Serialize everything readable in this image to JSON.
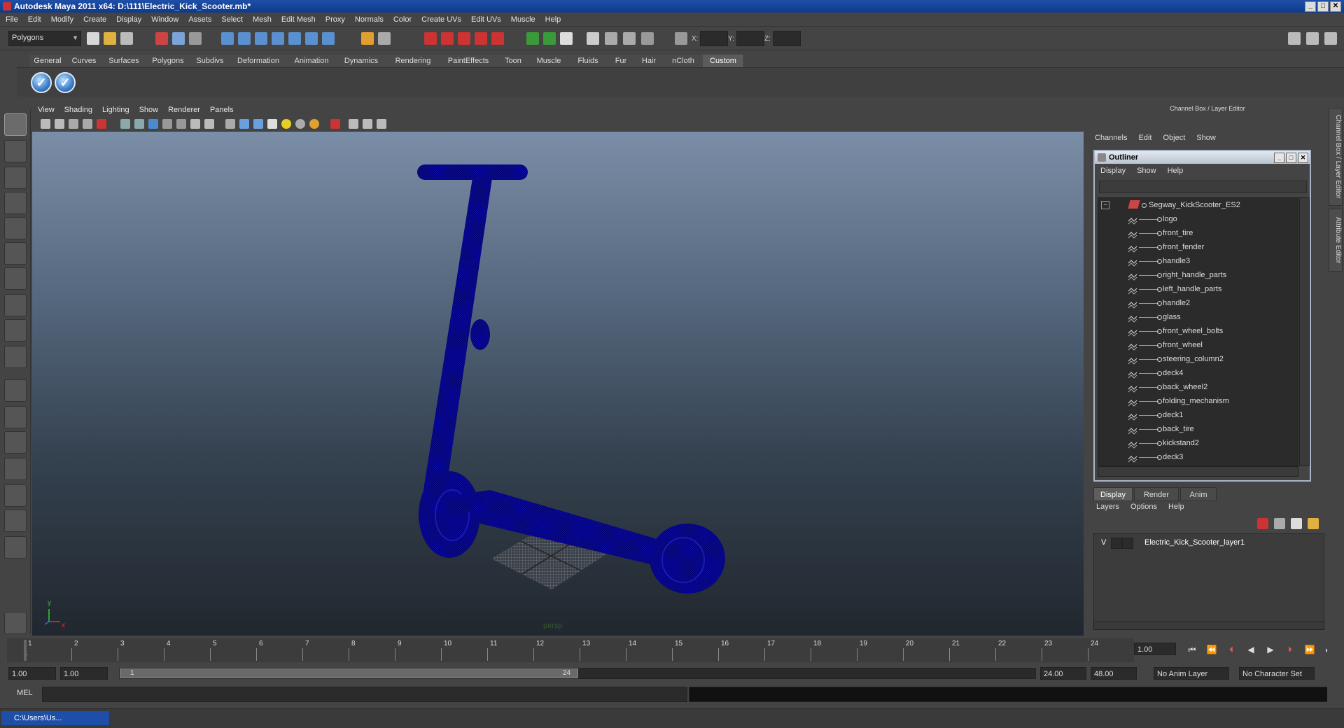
{
  "window": {
    "title": "Autodesk Maya 2011 x64: D:\\111\\Electric_Kick_Scooter.mb*"
  },
  "menubar": [
    "File",
    "Edit",
    "Modify",
    "Create",
    "Display",
    "Window",
    "Assets",
    "Select",
    "Mesh",
    "Edit Mesh",
    "Proxy",
    "Normals",
    "Color",
    "Create UVs",
    "Edit UVs",
    "Muscle",
    "Help"
  ],
  "statusline": {
    "mode": "Polygons",
    "x_label": "X:",
    "y_label": "Y:",
    "z_label": "Z:"
  },
  "shelf": {
    "tabs": [
      "General",
      "Curves",
      "Surfaces",
      "Polygons",
      "Subdivs",
      "Deformation",
      "Animation",
      "Dynamics",
      "Rendering",
      "PaintEffects",
      "Toon",
      "Muscle",
      "Fluids",
      "Fur",
      "Hair",
      "nCloth",
      "Custom"
    ],
    "active_tab": "Custom",
    "icons": [
      "check-icon",
      "check-icon"
    ]
  },
  "viewport": {
    "menu": [
      "View",
      "Shading",
      "Lighting",
      "Show",
      "Renderer",
      "Panels"
    ],
    "camera_label": "persp",
    "axis": {
      "y": "y",
      "x": "x",
      "z": "z"
    },
    "wireframe_color": "#00007a"
  },
  "timeline": {
    "ticks": [
      "1",
      "2",
      "3",
      "4",
      "5",
      "6",
      "7",
      "8",
      "9",
      "10",
      "11",
      "12",
      "13",
      "14",
      "15",
      "16",
      "17",
      "18",
      "19",
      "20",
      "21",
      "22",
      "23",
      "24"
    ],
    "current_marker": "1",
    "current_frame": "1.00"
  },
  "range": {
    "start": "1.00",
    "start2": "1.00",
    "slider_start": "1",
    "slider_end": "24",
    "end": "24.00",
    "end2": "48.00",
    "anim_layer": "No Anim Layer",
    "character_set": "No Character Set"
  },
  "cmdline": {
    "label": "MEL"
  },
  "taskbar": {
    "item": "C:\\Users\\Us..."
  },
  "channelbox": {
    "header": "Channel Box / Layer Editor",
    "menu": [
      "Channels",
      "Edit",
      "Object",
      "Show"
    ],
    "side_tabs": [
      "Channel Box / Layer Editor",
      "Attribute Editor"
    ]
  },
  "outliner": {
    "title": "Outliner",
    "menu": [
      "Display",
      "Show",
      "Help"
    ],
    "root": "Segway_KickScooter_ES2",
    "items": [
      "logo",
      "front_tire",
      "front_fender",
      "handle3",
      "right_handle_parts",
      "left_handle_parts",
      "handle2",
      "glass",
      "front_wheel_bolts",
      "front_wheel",
      "steering_column2",
      "deck4",
      "back_wheel2",
      "folding_mechanism",
      "deck1",
      "back_tire",
      "kickstand2",
      "deck3"
    ]
  },
  "layers": {
    "tabs": [
      "Display",
      "Render",
      "Anim"
    ],
    "active_tab": "Display",
    "menu": [
      "Layers",
      "Options",
      "Help"
    ],
    "layer_visible": "V",
    "layer_name": "Electric_Kick_Scooter_layer1"
  }
}
